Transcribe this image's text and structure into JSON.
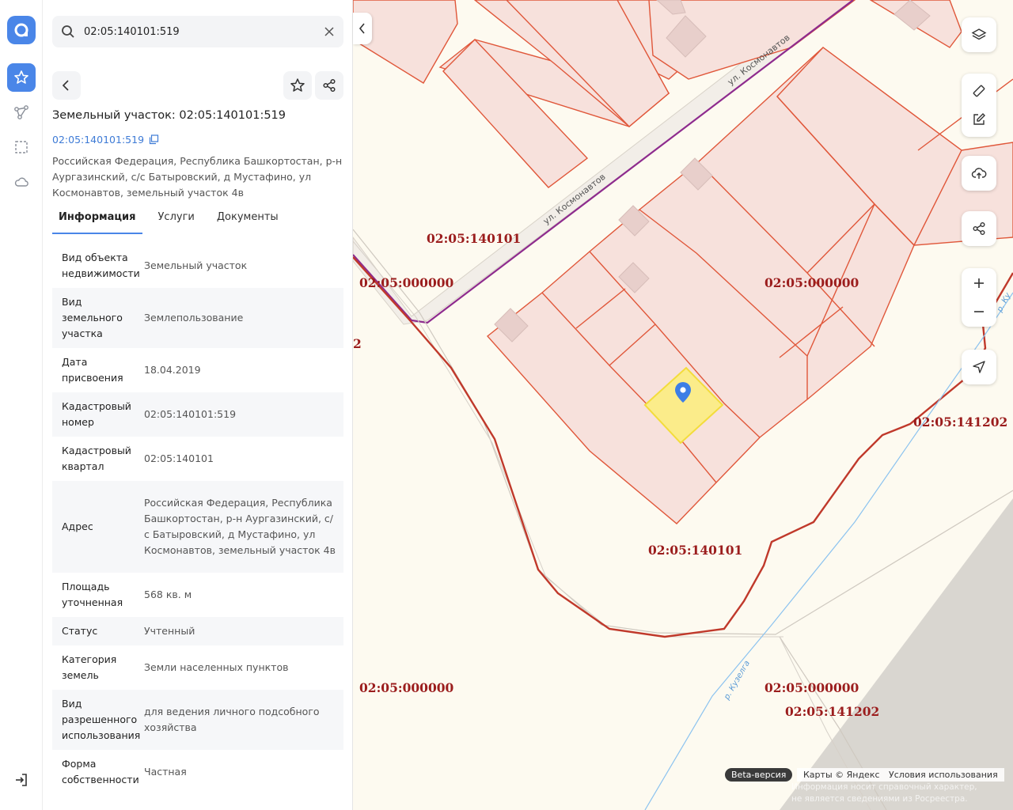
{
  "search": {
    "value": "02:05:140101:519"
  },
  "object": {
    "title": "Земельный участок: 02:05:140101:519",
    "cad_number_link": "02:05:140101:519",
    "address": "Российская Федерация, Республика Башкортостан, р-н Аургазинский, с/с Батыровский, д Мустафино, ул Космонавтов, земельный участок 4в"
  },
  "tabs": [
    {
      "label": "Информация",
      "active": true
    },
    {
      "label": "Услуги",
      "active": false
    },
    {
      "label": "Документы",
      "active": false
    }
  ],
  "info_rows": [
    {
      "key": "Вид объекта недвижимости",
      "value": "Земельный участок"
    },
    {
      "key": "Вид земельного участка",
      "value": "Землепользование"
    },
    {
      "key": "Дата присвоения",
      "value": "18.04.2019"
    },
    {
      "key": "Кадастровый номер",
      "value": "02:05:140101:519"
    },
    {
      "key": "Кадастровый квартал",
      "value": "02:05:140101"
    },
    {
      "key": "Адрес",
      "value": "Российская Федерация, Республика Башкортостан, р-н Аургазинский, с/с Батыровский, д Мустафино, ул Космонавтов, земельный участок 4в"
    },
    {
      "key": "Площадь уточненная",
      "value": "568 кв. м"
    },
    {
      "key": "Статус",
      "value": "Учтенный"
    },
    {
      "key": "Категория земель",
      "value": "Земли населенных пунктов"
    },
    {
      "key": "Вид разрешенного использования",
      "value": "для ведения личного подсобного хозяйства"
    },
    {
      "key": "Форма собственности",
      "value": "Частная"
    }
  ],
  "map": {
    "street_label": "ул. Космонавтов",
    "river_label": "р. Кузелга",
    "river_label_partial": "р. Ку",
    "cadastral_labels": [
      "02:05:140101",
      "02:05:000000",
      "02:05:000000",
      "2",
      "02:05:141202",
      "02:05:140101",
      "02:05:000000",
      "02:05:000000",
      "02:05:141202"
    ]
  },
  "footer": {
    "beta": "Beta-версия",
    "attribution": "Карты © Яндекс",
    "terms": "Условия использования",
    "disclaimer": "Информация носит справочный характер, не является сведениями из Росреестра."
  },
  "colors": {
    "accent": "#4a86e8",
    "parcel_border": "#e0573a",
    "parcel_fill": "#f7e1dc",
    "selected_parcel": "#fbec8a",
    "boundary": "#c0392b",
    "road": "#8e2b8e",
    "cadastral_label": "#9b1d1d"
  }
}
